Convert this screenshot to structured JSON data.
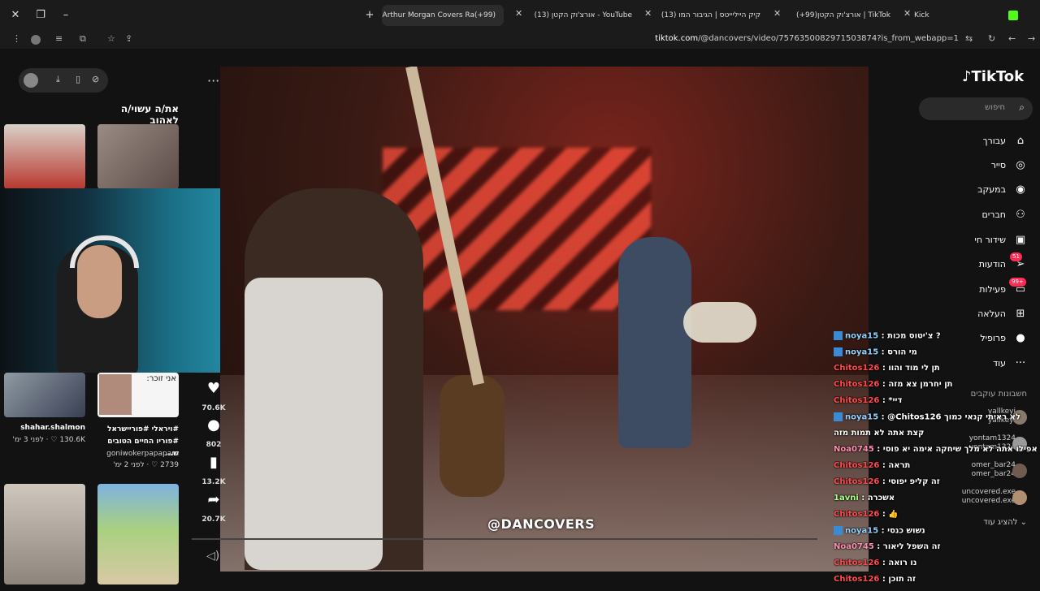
{
  "browser": {
    "tabs": [
      {
        "label": "(99+)Arthur Morgan Covers Ra",
        "active": true
      },
      {
        "label": "YouTube - אורצ'וק הקטן (13)",
        "active": false
      },
      {
        "label": "קיק הייליייטס | הגיבור המו (13)",
        "active": false
      },
      {
        "label": "TikTok | אורצ'וק הקטן(99+)",
        "active": false
      },
      {
        "label": "Kick",
        "active": false
      }
    ],
    "url_host": "tiktok.com",
    "url_path": "/@dancovers/video/7576350082971503874?is_from_webapp=1"
  },
  "left": {
    "section_title": "את/ה עשוי/ה לאהוב",
    "items": [
      {
        "author": "shahar.shalmon",
        "stats": "130.6K ♡ · לפני 3 ימ'"
      },
      {
        "caption": "#ויראלי #פוריישראל #פוריו החיים הטובים ש...",
        "author": "goniwokerpapapam",
        "stats": "2739 ♡ · לפני 2 ימ'",
        "overlay": "אני זוכר:"
      }
    ]
  },
  "video": {
    "watermark": "@DANCOVERS",
    "actions": [
      {
        "icon": "heart-icon",
        "count": "70.6K"
      },
      {
        "icon": "comment-icon",
        "count": "802"
      },
      {
        "icon": "bookmark-icon",
        "count": "13.2K"
      },
      {
        "icon": "share-icon",
        "count": "20.7K"
      }
    ]
  },
  "right": {
    "logo": "TikTok",
    "search_placeholder": "חיפוש",
    "nav": [
      {
        "label": "עבורך",
        "icon": "home-icon"
      },
      {
        "label": "סייר",
        "icon": "compass-icon"
      },
      {
        "label": "במעקב",
        "icon": "following-icon"
      },
      {
        "label": "חברים",
        "icon": "friends-icon"
      },
      {
        "label": "שידור חי",
        "icon": "live-icon"
      },
      {
        "label": "הודעות",
        "icon": "messages-icon",
        "badge": "51"
      },
      {
        "label": "פעילות",
        "icon": "activity-icon",
        "badge": "99+"
      },
      {
        "label": "העלאה",
        "icon": "upload-icon"
      },
      {
        "label": "פרופיל",
        "icon": "profile-icon"
      },
      {
        "label": "עוד",
        "icon": "more-icon"
      }
    ],
    "following_title": "חשבונות עוקבים",
    "following": [
      {
        "name": "yallkeyi",
        "sub": "yallkeyi"
      },
      {
        "name": "yontam1324",
        "sub": "yontam1324"
      },
      {
        "name": "omer_bar24",
        "sub": "omer_bar24"
      },
      {
        "name": "uncovered.exe",
        "sub": "uncovered.exe"
      }
    ],
    "show_more": "להציג עוד"
  },
  "chat": [
    {
      "user": "noya15",
      "color": "u-blue",
      "badge": true,
      "msg": "צ'יטוס מכות ?"
    },
    {
      "user": "noya15",
      "color": "u-blue",
      "badge": true,
      "msg": "מי הורס"
    },
    {
      "user": "Chitos126",
      "color": "u-red",
      "badge": false,
      "msg": "תן לי מוד והוו"
    },
    {
      "user": "Chitos126",
      "color": "u-red",
      "badge": false,
      "msg": "תן יחרמן צא מזה"
    },
    {
      "user": "Chitos126",
      "color": "u-red",
      "badge": false,
      "msg": "*דיי"
    },
    {
      "user": "noya15",
      "color": "u-blue",
      "badge": true,
      "msg": "@Chitos126 לא ראיתי קנאי כמוך"
    },
    {
      "user": "",
      "color": "u-blue",
      "badge": false,
      "msg": "קצת אתה לא תמות מזה"
    },
    {
      "user": "Noa0745",
      "color": "u-pink",
      "badge": false,
      "msg": "אפילו אתה לא מלך שיחקה אימה יא פוסי"
    },
    {
      "user": "Chitos126",
      "color": "u-red",
      "badge": false,
      "msg": "תראה"
    },
    {
      "user": "Chitos126",
      "color": "u-red",
      "badge": false,
      "msg": "זה קליפ יפוסי"
    },
    {
      "user": "1avni",
      "color": "u-green",
      "badge": false,
      "msg": "אשכרה"
    },
    {
      "user": "Chitos126",
      "color": "u-red",
      "badge": false,
      "msg": "👍"
    },
    {
      "user": "noya15",
      "color": "u-blue",
      "badge": true,
      "msg": "נשוש כנסי"
    },
    {
      "user": "Noa0745",
      "color": "u-pink",
      "badge": false,
      "msg": "זה השפל ליאור"
    },
    {
      "user": "Chitos126",
      "color": "u-red",
      "badge": false,
      "msg": "נו רואה"
    },
    {
      "user": "Chitos126",
      "color": "u-red",
      "badge": false,
      "msg": "זה תוכן"
    }
  ]
}
